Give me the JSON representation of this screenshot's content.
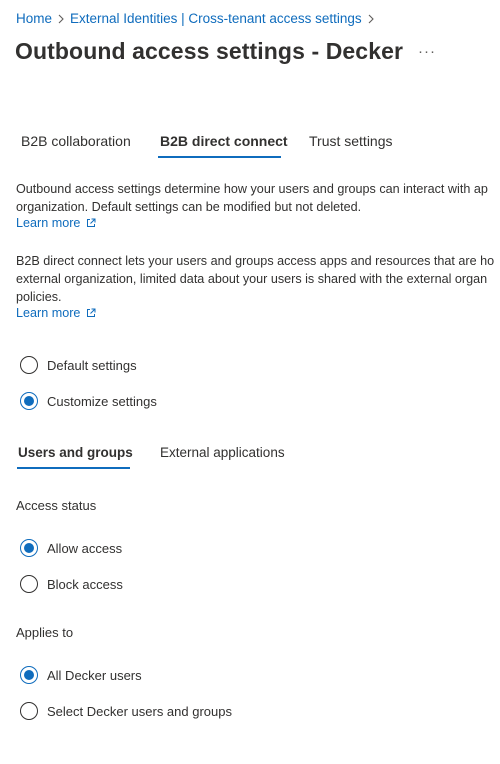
{
  "breadcrumb": {
    "home": "Home",
    "external": "External Identities | Cross-tenant access settings"
  },
  "page": {
    "title": "Outbound access settings - Decker",
    "more": "···"
  },
  "tabs": [
    {
      "label": "B2B collaboration",
      "active": false
    },
    {
      "label": "B2B direct connect",
      "active": true
    },
    {
      "label": "Trust settings",
      "active": false
    }
  ],
  "intro": {
    "line1": "Outbound access settings determine how your users and groups can interact with ap",
    "line2": "organization. Default settings can be modified but not deleted.",
    "learn_more": "Learn more"
  },
  "direct_connect_info": {
    "line1": "B2B direct connect lets your users and groups access apps and resources that are ho",
    "line2": "external organization, limited data about your users is shared with the external organ",
    "line3": "policies.",
    "learn_more": "Learn more"
  },
  "settings_mode": {
    "options": [
      {
        "label": "Default settings",
        "selected": false
      },
      {
        "label": "Customize settings",
        "selected": true
      }
    ]
  },
  "sub_tabs": [
    {
      "label": "Users and groups",
      "active": true
    },
    {
      "label": "External applications",
      "active": false
    }
  ],
  "access_status": {
    "label": "Access status",
    "options": [
      {
        "label": "Allow access",
        "selected": true
      },
      {
        "label": "Block access",
        "selected": false
      }
    ]
  },
  "applies_to": {
    "label": "Applies to",
    "options": [
      {
        "label": "All Decker users",
        "selected": true
      },
      {
        "label": "Select Decker users and groups",
        "selected": false
      }
    ]
  },
  "colors": {
    "accent": "#0f6cbd",
    "text": "#323130"
  }
}
